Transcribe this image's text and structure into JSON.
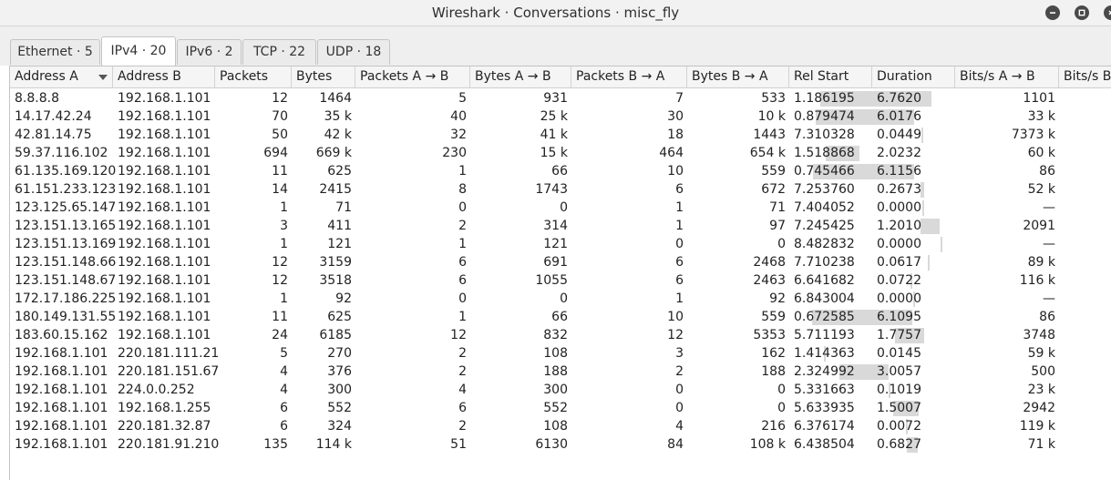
{
  "window": {
    "title": "Wireshark · Conversations · misc_fly",
    "buttons": [
      "minimize-icon",
      "maximize-icon",
      "close-icon"
    ]
  },
  "tabs": [
    {
      "label": "Ethernet · 5",
      "active": false
    },
    {
      "label": "IPv4 · 20",
      "active": true
    },
    {
      "label": "IPv6 · 2",
      "active": false
    },
    {
      "label": "TCP · 22",
      "active": false
    },
    {
      "label": "UDP · 18",
      "active": false
    }
  ],
  "columns": [
    "Address A",
    "Address B",
    "Packets",
    "Bytes",
    "Packets A → B",
    "Bytes A → B",
    "Packets B → A",
    "Bytes B → A",
    "Rel Start",
    "Duration",
    "Bits/s A → B",
    "Bits/s B"
  ],
  "sort_column": "Address A",
  "rows": [
    [
      "8.8.8.8",
      "192.168.1.101",
      "12",
      "1464",
      "5",
      "931",
      "7",
      "533",
      "1.186195",
      "6.7620",
      "1101",
      ""
    ],
    [
      "14.17.42.24",
      "192.168.1.101",
      "70",
      "35 k",
      "40",
      "25 k",
      "30",
      "10 k",
      "0.879474",
      "6.0176",
      "33 k",
      ""
    ],
    [
      "42.81.14.75",
      "192.168.1.101",
      "50",
      "42 k",
      "32",
      "41 k",
      "18",
      "1443",
      "7.310328",
      "0.0449",
      "7373 k",
      ""
    ],
    [
      "59.37.116.102",
      "192.168.1.101",
      "694",
      "669 k",
      "230",
      "15 k",
      "464",
      "654 k",
      "1.518868",
      "2.0232",
      "60 k",
      ""
    ],
    [
      "61.135.169.120",
      "192.168.1.101",
      "11",
      "625",
      "1",
      "66",
      "10",
      "559",
      "0.745466",
      "6.1156",
      "86",
      ""
    ],
    [
      "61.151.233.123",
      "192.168.1.101",
      "14",
      "2415",
      "8",
      "1743",
      "6",
      "672",
      "7.253760",
      "0.2673",
      "52 k",
      ""
    ],
    [
      "123.125.65.147",
      "192.168.1.101",
      "1",
      "71",
      "0",
      "0",
      "1",
      "71",
      "7.404052",
      "0.0000",
      "—",
      ""
    ],
    [
      "123.151.13.165",
      "192.168.1.101",
      "3",
      "411",
      "2",
      "314",
      "1",
      "97",
      "7.245425",
      "1.2010",
      "2091",
      ""
    ],
    [
      "123.151.13.169",
      "192.168.1.101",
      "1",
      "121",
      "1",
      "121",
      "0",
      "0",
      "8.482832",
      "0.0000",
      "—",
      ""
    ],
    [
      "123.151.148.66",
      "192.168.1.101",
      "12",
      "3159",
      "6",
      "691",
      "6",
      "2468",
      "7.710238",
      "0.0617",
      "89 k",
      ""
    ],
    [
      "123.151.148.67",
      "192.168.1.101",
      "12",
      "3518",
      "6",
      "1055",
      "6",
      "2463",
      "6.641682",
      "0.0722",
      "116 k",
      ""
    ],
    [
      "172.17.186.225",
      "192.168.1.101",
      "1",
      "92",
      "0",
      "0",
      "1",
      "92",
      "6.843004",
      "0.0000",
      "—",
      ""
    ],
    [
      "180.149.131.55",
      "192.168.1.101",
      "11",
      "625",
      "1",
      "66",
      "10",
      "559",
      "0.672585",
      "6.1095",
      "86",
      ""
    ],
    [
      "183.60.15.162",
      "192.168.1.101",
      "24",
      "6185",
      "12",
      "832",
      "12",
      "5353",
      "5.711193",
      "1.7757",
      "3748",
      ""
    ],
    [
      "192.168.1.101",
      "220.181.111.21",
      "5",
      "270",
      "2",
      "108",
      "3",
      "162",
      "1.414363",
      "0.0145",
      "59 k",
      ""
    ],
    [
      "192.168.1.101",
      "220.181.151.67",
      "4",
      "376",
      "2",
      "188",
      "2",
      "188",
      "2.324992",
      "3.0057",
      "500",
      ""
    ],
    [
      "192.168.1.101",
      "224.0.0.252",
      "4",
      "300",
      "4",
      "300",
      "0",
      "0",
      "5.331663",
      "0.1019",
      "23 k",
      ""
    ],
    [
      "192.168.1.101",
      "192.168.1.255",
      "6",
      "552",
      "6",
      "552",
      "0",
      "0",
      "5.633935",
      "1.5007",
      "2942",
      ""
    ],
    [
      "192.168.1.101",
      "220.181.32.87",
      "6",
      "324",
      "2",
      "108",
      "4",
      "216",
      "6.376174",
      "0.0072",
      "119 k",
      ""
    ],
    [
      "192.168.1.101",
      "220.181.91.210",
      "135",
      "114 k",
      "51",
      "6130",
      "84",
      "108 k",
      "6.438504",
      "0.6827",
      "71 k",
      ""
    ]
  ],
  "timeline": {
    "capture_duration": 9.27,
    "color": "#d9d9d9"
  }
}
